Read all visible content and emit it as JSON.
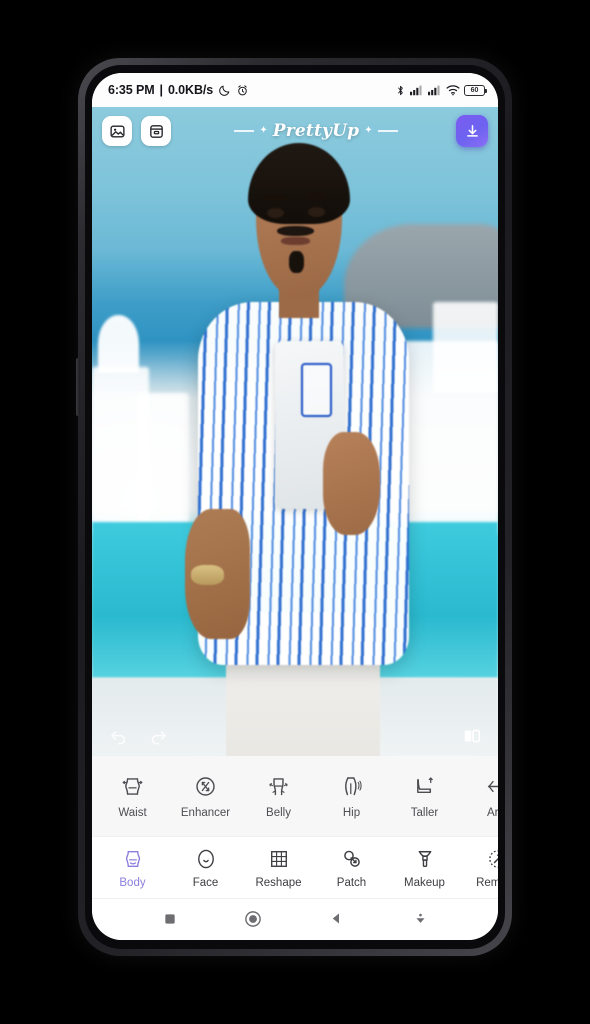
{
  "status_bar": {
    "time": "6:35 PM",
    "separator": "|",
    "network_speed": "0.0KB/s",
    "moon_icon": "moon-icon",
    "alarm_icon": "alarm-icon",
    "bluetooth_icon": "bluetooth-icon",
    "signal1_icon": "signal-bars-icon",
    "signal2_icon": "signal-bars-icon",
    "wifi_icon": "wifi-icon",
    "battery_level": "60"
  },
  "editor_top_bar": {
    "gallery_button": "gallery-icon",
    "albums_button": "albums-icon",
    "app_title": "PrettyUp",
    "left_spark": "✦",
    "right_spark": "✦",
    "download_button": "download-icon"
  },
  "photo_overlay": {
    "undo_button": "undo-icon",
    "redo_button": "redo-icon",
    "compare_button": "compare-icon"
  },
  "tool_strip": {
    "items": [
      {
        "label": "Waist",
        "icon": "waist-icon"
      },
      {
        "label": "Enhancer",
        "icon": "enhancer-icon"
      },
      {
        "label": "Belly",
        "icon": "belly-icon"
      },
      {
        "label": "Hip",
        "icon": "hip-icon"
      },
      {
        "label": "Taller",
        "icon": "taller-icon"
      },
      {
        "label": "Arm",
        "icon": "arm-icon"
      }
    ]
  },
  "bottom_nav": {
    "active_index": 0,
    "items": [
      {
        "label": "Body",
        "icon": "body-icon"
      },
      {
        "label": "Face",
        "icon": "face-icon"
      },
      {
        "label": "Reshape",
        "icon": "reshape-grid-icon"
      },
      {
        "label": "Patch",
        "icon": "patch-icon"
      },
      {
        "label": "Makeup",
        "icon": "makeup-brush-icon"
      },
      {
        "label": "Remove",
        "icon": "remove-icon"
      }
    ]
  },
  "system_nav": {
    "recents_button": "square-recents-icon",
    "home_button": "circle-home-icon",
    "back_button": "triangle-back-icon",
    "hide_button": "double-chevron-down-icon"
  },
  "colors": {
    "accent_purple": "#8b7ede",
    "download_gradient_start": "#7b5cf0",
    "download_gradient_end": "#8b6ef5",
    "tool_label": "#4d4d52",
    "nav_label": "#3d3d42",
    "tool_strip_bg": "#f7f7f8",
    "status_bg": "#fdfdfd"
  }
}
